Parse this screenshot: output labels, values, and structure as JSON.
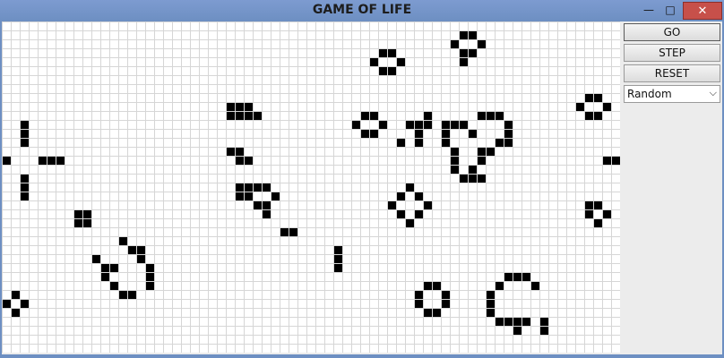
{
  "window": {
    "title": "GAME OF LIFE",
    "controls": {
      "minimize_icon": "minimize-icon",
      "maximize_icon": "maximize-icon",
      "close_icon": "close-icon"
    },
    "close_symbol": "✕",
    "minimize_symbol": "—",
    "maximize_symbol": "□"
  },
  "controls": {
    "go_label": "GO",
    "step_label": "STEP",
    "reset_label": "RESET",
    "pattern_select": {
      "selected": "Random",
      "arrow_symbol": "⌵"
    }
  },
  "board": {
    "columns": 69,
    "rows": 37,
    "cell_color": "#000000",
    "grid_color": "#d6d6d6",
    "background": "#ffffff",
    "live_cells": [
      [
        51,
        1
      ],
      [
        52,
        1
      ],
      [
        42,
        3
      ],
      [
        43,
        3
      ],
      [
        50,
        2
      ],
      [
        53,
        2
      ],
      [
        41,
        4
      ],
      [
        44,
        4
      ],
      [
        51,
        3
      ],
      [
        52,
        3
      ],
      [
        42,
        5
      ],
      [
        43,
        5
      ],
      [
        51,
        4
      ],
      [
        65,
        8
      ],
      [
        66,
        8
      ],
      [
        25,
        9
      ],
      [
        26,
        9
      ],
      [
        27,
        9
      ],
      [
        25,
        10
      ],
      [
        26,
        10
      ],
      [
        27,
        10
      ],
      [
        28,
        10
      ],
      [
        64,
        9
      ],
      [
        67,
        9
      ],
      [
        65,
        10
      ],
      [
        66,
        10
      ],
      [
        40,
        10
      ],
      [
        41,
        10
      ],
      [
        39,
        11
      ],
      [
        42,
        11
      ],
      [
        40,
        12
      ],
      [
        41,
        12
      ],
      [
        47,
        10
      ],
      [
        45,
        11
      ],
      [
        46,
        11
      ],
      [
        47,
        11
      ],
      [
        46,
        12
      ],
      [
        44,
        13
      ],
      [
        46,
        13
      ],
      [
        49,
        11
      ],
      [
        50,
        11
      ],
      [
        51,
        11
      ],
      [
        53,
        10
      ],
      [
        54,
        10
      ],
      [
        55,
        10
      ],
      [
        56,
        11
      ],
      [
        49,
        12
      ],
      [
        52,
        12
      ],
      [
        56,
        12
      ],
      [
        49,
        13
      ],
      [
        55,
        13
      ],
      [
        56,
        13
      ],
      [
        50,
        14
      ],
      [
        53,
        14
      ],
      [
        54,
        14
      ],
      [
        50,
        15
      ],
      [
        53,
        15
      ],
      [
        50,
        16
      ],
      [
        52,
        16
      ],
      [
        51,
        17
      ],
      [
        52,
        17
      ],
      [
        53,
        17
      ],
      [
        2,
        11
      ],
      [
        2,
        12
      ],
      [
        2,
        13
      ],
      [
        25,
        14
      ],
      [
        26,
        14
      ],
      [
        26,
        15
      ],
      [
        27,
        15
      ],
      [
        0,
        15
      ],
      [
        4,
        15
      ],
      [
        5,
        15
      ],
      [
        6,
        15
      ],
      [
        67,
        15
      ],
      [
        68,
        15
      ],
      [
        2,
        17
      ],
      [
        2,
        18
      ],
      [
        2,
        19
      ],
      [
        26,
        18
      ],
      [
        27,
        18
      ],
      [
        28,
        18
      ],
      [
        29,
        18
      ],
      [
        26,
        19
      ],
      [
        27,
        19
      ],
      [
        30,
        19
      ],
      [
        28,
        20
      ],
      [
        29,
        20
      ],
      [
        29,
        21
      ],
      [
        45,
        18
      ],
      [
        44,
        19
      ],
      [
        46,
        19
      ],
      [
        43,
        20
      ],
      [
        47,
        20
      ],
      [
        44,
        21
      ],
      [
        46,
        21
      ],
      [
        45,
        22
      ],
      [
        65,
        20
      ],
      [
        66,
        20
      ],
      [
        65,
        21
      ],
      [
        67,
        21
      ],
      [
        66,
        22
      ],
      [
        8,
        21
      ],
      [
        9,
        21
      ],
      [
        8,
        22
      ],
      [
        9,
        22
      ],
      [
        31,
        23
      ],
      [
        32,
        23
      ],
      [
        13,
        24
      ],
      [
        14,
        25
      ],
      [
        15,
        25
      ],
      [
        10,
        26
      ],
      [
        15,
        26
      ],
      [
        11,
        27
      ],
      [
        12,
        27
      ],
      [
        16,
        27
      ],
      [
        11,
        28
      ],
      [
        16,
        28
      ],
      [
        12,
        29
      ],
      [
        16,
        29
      ],
      [
        13,
        30
      ],
      [
        14,
        30
      ],
      [
        37,
        25
      ],
      [
        37,
        26
      ],
      [
        37,
        27
      ],
      [
        56,
        28
      ],
      [
        57,
        28
      ],
      [
        58,
        28
      ],
      [
        47,
        29
      ],
      [
        48,
        29
      ],
      [
        55,
        29
      ],
      [
        59,
        29
      ],
      [
        46,
        30
      ],
      [
        49,
        30
      ],
      [
        54,
        30
      ],
      [
        46,
        31
      ],
      [
        49,
        31
      ],
      [
        54,
        31
      ],
      [
        47,
        32
      ],
      [
        48,
        32
      ],
      [
        54,
        32
      ],
      [
        1,
        30
      ],
      [
        0,
        31
      ],
      [
        2,
        31
      ],
      [
        1,
        32
      ],
      [
        55,
        33
      ],
      [
        56,
        33
      ],
      [
        57,
        33
      ],
      [
        58,
        33
      ],
      [
        60,
        33
      ],
      [
        57,
        34
      ],
      [
        60,
        34
      ]
    ]
  }
}
